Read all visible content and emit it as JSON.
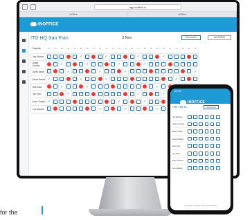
{
  "browser": {
    "url": "app.inoffice.io",
    "tabs": [
      "inOffice",
      "inOffice"
    ]
  },
  "app": {
    "brand": "INOFFICE",
    "location": "ITO HQ San Fran",
    "date_nav": "3 Nov",
    "view": "Workweek",
    "actions_label": "ACTIONS"
  },
  "grid": {
    "capacity_label": "Capacity",
    "days": [
      "03",
      "04",
      "05",
      "06",
      "07",
      "08",
      "09",
      "10",
      "11",
      "12",
      "13",
      "14",
      "15",
      "16",
      "17",
      "18",
      "19",
      "20",
      "21",
      "22",
      "23",
      "24",
      "25",
      "26"
    ],
    "people": [
      "Jay Rickms",
      "Adam Guntey",
      "Darth Vader",
      "Darus Bekler",
      "Han Solo",
      "Jyn Erso",
      "Kanz Thrace",
      "Lee Adama"
    ]
  },
  "phone": {
    "time": "09:00",
    "title": "ITO HQ S...",
    "view": "Workweek",
    "footer": "Copyright © inOffice Online Limited 2022"
  },
  "caption": {
    "text": "for the"
  }
}
